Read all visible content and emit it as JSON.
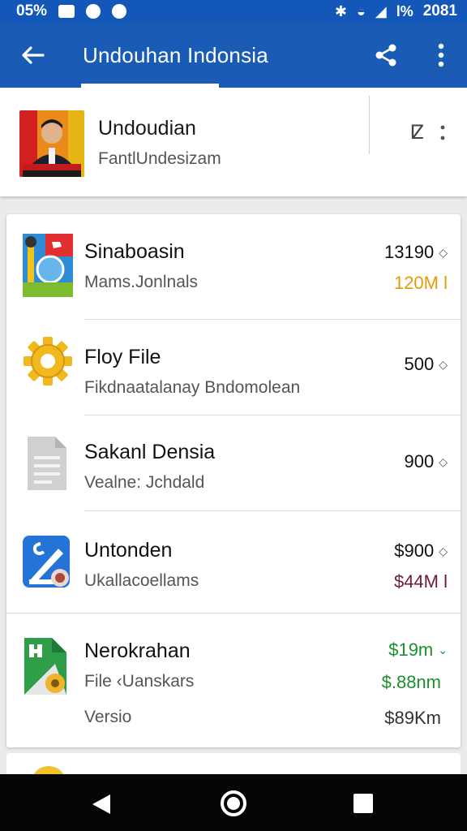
{
  "status_bar": {
    "left_text": "05%",
    "right_text": "2081",
    "battery_text": "l%"
  },
  "app_bar": {
    "title": "Undouhan Indonsia",
    "back_icon": "arrow-left-icon",
    "share_icon": "share-icon",
    "more_icon": "more-vert-icon"
  },
  "profile": {
    "name": "Undoudian",
    "subtitle": "FantlUndesizam",
    "refresh_glyph": "ⵇ"
  },
  "list": {
    "items": [
      {
        "title": "Sinaboasin",
        "subtitle": "Mams.Jonlnals",
        "value": "13190",
        "value2": "120M l",
        "value2_color": "#e69a06",
        "icon": "flag-badge-icon"
      },
      {
        "title": "Floy File",
        "subtitle": "Fikdnaatalanay Bndomolean",
        "value": "500",
        "icon": "gear-icon"
      },
      {
        "title": "Sakanl Densia",
        "subtitle": "Vealne: Jchdald",
        "value": "900",
        "icon": "document-icon"
      },
      {
        "title": "Untonden",
        "subtitle": "Ukallacoellams",
        "value": "$900",
        "value2": "$44M l",
        "value2_color": "#6e1b3a",
        "icon": "blue-app-icon"
      },
      {
        "title": "Nerokrahan",
        "subtitle": "File ‹Uanskars",
        "value": "$19m",
        "value_color": "#1b8f2e",
        "value2": "$.88nm",
        "value2_color": "#1b8f2e",
        "extra_label": "Versio",
        "extra_value": "$89Km",
        "icon": "green-file-icon"
      }
    ]
  },
  "colors": {
    "primary": "#1a5bb6",
    "status": "#1358b8",
    "nav": "#050505"
  }
}
